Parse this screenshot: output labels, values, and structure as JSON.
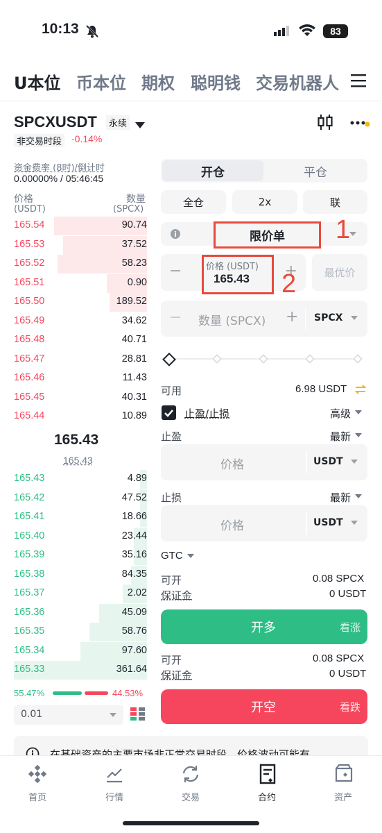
{
  "status": {
    "time": "10:13",
    "battery": "83"
  },
  "tabs": [
    "U本位",
    "币本位",
    "期权",
    "聪明钱",
    "交易机器人"
  ],
  "symbol": {
    "name": "SPCXUSDT",
    "type": "永续",
    "session": "非交易时段",
    "change": "-0.14%"
  },
  "funding": {
    "label": "资金费率 (8时)/倒计时",
    "value": "0.00000% / 05:46:45"
  },
  "orderbook": {
    "price_label": "价格",
    "price_unit": "(USDT)",
    "qty_label": "数量",
    "qty_unit": "(SPCX)",
    "asks": [
      {
        "price": "165.54",
        "qty": "90.74",
        "depth": 0.7
      },
      {
        "price": "165.53",
        "qty": "37.52",
        "depth": 0.63
      },
      {
        "price": "165.52",
        "qty": "58.23",
        "depth": 0.67
      },
      {
        "price": "165.51",
        "qty": "0.90",
        "depth": 0.3
      },
      {
        "price": "165.50",
        "qty": "189.52",
        "depth": 0.28
      },
      {
        "price": "165.49",
        "qty": "34.62",
        "depth": 0
      },
      {
        "price": "165.48",
        "qty": "40.71",
        "depth": 0
      },
      {
        "price": "165.47",
        "qty": "28.81",
        "depth": 0
      },
      {
        "price": "165.46",
        "qty": "11.43",
        "depth": 0
      },
      {
        "price": "165.45",
        "qty": "40.31",
        "depth": 0
      },
      {
        "price": "165.44",
        "qty": "10.89",
        "depth": 0
      }
    ],
    "last_price": "165.43",
    "mark_price": "165.43",
    "bids": [
      {
        "price": "165.43",
        "qty": "4.89",
        "depth": 0.05
      },
      {
        "price": "165.42",
        "qty": "47.52",
        "depth": 0.05
      },
      {
        "price": "165.41",
        "qty": "18.66",
        "depth": 0.05
      },
      {
        "price": "165.40",
        "qty": "23.44",
        "depth": 0.1
      },
      {
        "price": "165.39",
        "qty": "35.16",
        "depth": 0.1
      },
      {
        "price": "165.38",
        "qty": "84.35",
        "depth": 0.12
      },
      {
        "price": "165.37",
        "qty": "2.02",
        "depth": 0.18
      },
      {
        "price": "165.36",
        "qty": "45.09",
        "depth": 0.36
      },
      {
        "price": "165.35",
        "qty": "58.76",
        "depth": 0.43
      },
      {
        "price": "165.34",
        "qty": "97.60",
        "depth": 0.5
      },
      {
        "price": "165.33",
        "qty": "361.64",
        "depth": 1.0
      }
    ],
    "buy_ratio": "55.47%",
    "sell_ratio": "44.53%",
    "buy_fraction": 0.5547,
    "precision": "0.01"
  },
  "form": {
    "open_tab": "开仓",
    "close_tab": "平仓",
    "margin_mode": "全仓",
    "leverage": "2x",
    "asset_mode": "联",
    "order_type": "限价单",
    "annotation1": "1",
    "annotation2": "2",
    "price_label": "价格 (USDT)",
    "price_value": "165.43",
    "best_price": "最优价",
    "qty_placeholder": "数量 (SPCX)",
    "qty_unit": "SPCX",
    "available_label": "可用",
    "available_value": "6.98 USDT",
    "tpsl_label": "止盈/止损",
    "advanced": "高级",
    "tp_label": "止盈",
    "tp_mode": "最新",
    "tp_placeholder": "价格",
    "tp_unit": "USDT",
    "sl_label": "止损",
    "sl_mode": "最新",
    "sl_placeholder": "价格",
    "sl_unit": "USDT",
    "tif": "GTC",
    "long": {
      "can_open_label": "可开",
      "can_open": "0.08 SPCX",
      "margin_label": "保证金",
      "margin": "0 USDT",
      "button": "开多",
      "sub": "看涨"
    },
    "short": {
      "can_open_label": "可开",
      "can_open": "0.08 SPCX",
      "margin_label": "保证金",
      "margin": "0 USDT",
      "button": "开空",
      "sub": "看跌"
    }
  },
  "notice": "在基础资产的主要市场非正常交易时段，价格波动可能有",
  "nav": [
    "首页",
    "行情",
    "交易",
    "合约",
    "资产"
  ],
  "colors": {
    "red": "#f6465d",
    "green": "#2ebd85",
    "annotation": "#e84a3c"
  }
}
